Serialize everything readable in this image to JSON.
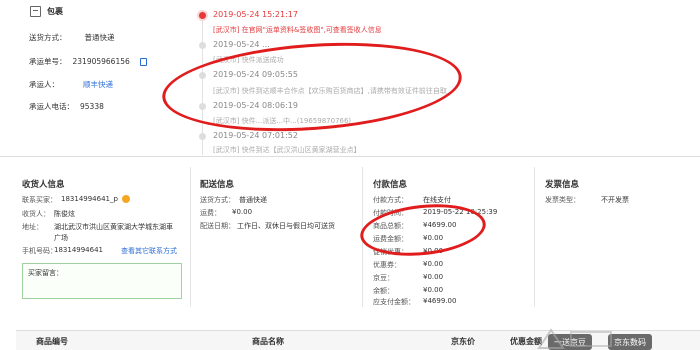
{
  "package": {
    "title": "包裹",
    "ship_method_label": "送货方式：",
    "ship_method": "普通快递",
    "tracking_label": "承运单号：",
    "tracking_no": "231905966156",
    "carrier_label": "承运人：",
    "carrier": "顺丰快递",
    "carrier_phone_label": "承运人电话：",
    "carrier_phone": "95338"
  },
  "timeline": [
    {
      "time": "2019-05-24 15:21:17",
      "text": "[武汉市] 在官网\"运单资料&签收图\",可查看签收人信息",
      "active": true
    },
    {
      "time": "2019-05-24 ...",
      "text": "[武汉市] 快件派送成功",
      "active": false
    },
    {
      "time": "2019-05-24 09:05:55",
      "text": "[武汉市] 快件到达顺丰合作点【欢乐购百货商店】,请携带有效证件前往自取",
      "active": false
    },
    {
      "time": "2019-05-24 08:06:19",
      "text": "[武汉市] 快件...派送...中...(19659870766)",
      "active": false
    },
    {
      "time": "2019-05-24 07:01:52",
      "text": "[武汉市] 快件到达【武汉洪山区黄家湖营业点】",
      "active": false
    }
  ],
  "receiver": {
    "title": "收货人信息",
    "contact_label": "联系买家：",
    "contact": "18314994641_p",
    "name_label": "收货人：",
    "name": "陈俊炫",
    "address_label": "地址：",
    "address": "湖北武汉市洪山区黄家湖大学城东湖車",
    "address2": "广场",
    "phone_label": "手机号码：",
    "phone": "18314994641",
    "view_other": "查看其它联系方式",
    "message_label": "买家留言："
  },
  "delivery": {
    "title": "配送信息",
    "method_label": "送货方式：",
    "method": "普通快递",
    "fee_label": "运费：",
    "fee": "¥0.00",
    "date_label": "配送日期：",
    "date": "工作日、双休日与假日均可送货"
  },
  "payment": {
    "title": "付款信息",
    "method_label": "付款方式：",
    "method": "在线支付",
    "time_label": "付款时间：",
    "time": "2019-05-22 10:25:39",
    "goods_label": "商品总额：",
    "goods": "¥4699.00",
    "freight_label": "运费金额：",
    "freight": "¥0.00",
    "promo_label": "促销优惠：",
    "promo": "¥0.00",
    "coupon_label": "优惠券：",
    "coupon": "¥0.00",
    "jd_label": "京豆：",
    "jd": "¥0.00",
    "balance_label": "余额：",
    "balance": "¥0.00",
    "total_label": "应支付金额：",
    "total": "¥4699.00"
  },
  "invoice": {
    "title": "发票信息",
    "type_label": "发票类型：",
    "type": "不开发票"
  },
  "products_head": {
    "col_id": "商品编号",
    "col_name": "商品名称",
    "col_price": "京东价",
    "col_discount": "优惠金额",
    "pill1": "一送京豆",
    "pill2": "京东数码"
  },
  "colors": {
    "accent_red": "#e4393c",
    "annotation_red": "#e11c1c",
    "link_blue": "#2b6cd4"
  }
}
